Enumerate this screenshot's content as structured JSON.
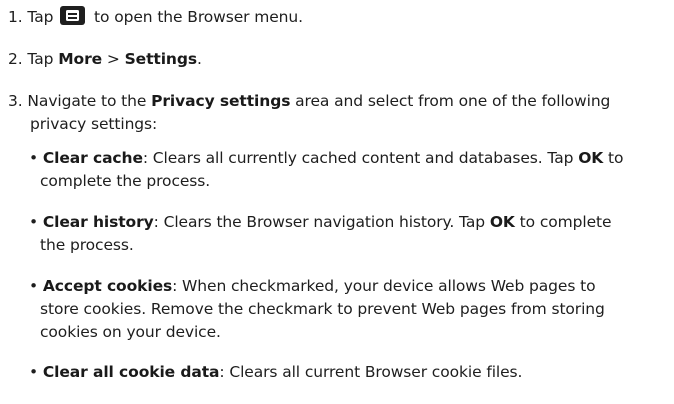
{
  "steps": [
    {
      "num": "1.",
      "pre": "Tap",
      "icon": "menu-icon",
      "post": "to open the Browser menu."
    },
    {
      "num": "2.",
      "pre": "Tap",
      "more": "More",
      "sep": ">",
      "settings": "Settings",
      "end": "."
    },
    {
      "num": "3.",
      "pre": "Navigate to the",
      "area": "Privacy settings",
      "post_line1": "area and select from one of the following",
      "post_line2": "privacy settings:"
    }
  ],
  "bullets": [
    {
      "title": "Clear cache",
      "text_a": ": Clears all currently cached content and databases. Tap",
      "ok": "OK",
      "text_b": "to complete the process."
    },
    {
      "title": "Clear history",
      "text_a": ": Clears the Browser navigation history. Tap",
      "ok": "OK",
      "text_b_line1": "to complete",
      "text_b_line2": "the process."
    },
    {
      "title": "Accept cookies",
      "line1": ": When checkmarked, your device allows Web pages to",
      "line2": "store cookies. Remove the checkmark to prevent Web pages from storing",
      "line3": "cookies on your device."
    },
    {
      "title": "Clear all cookie data",
      "text": ": Clears all current Browser cookie files."
    }
  ],
  "bullet_glyph": "•"
}
